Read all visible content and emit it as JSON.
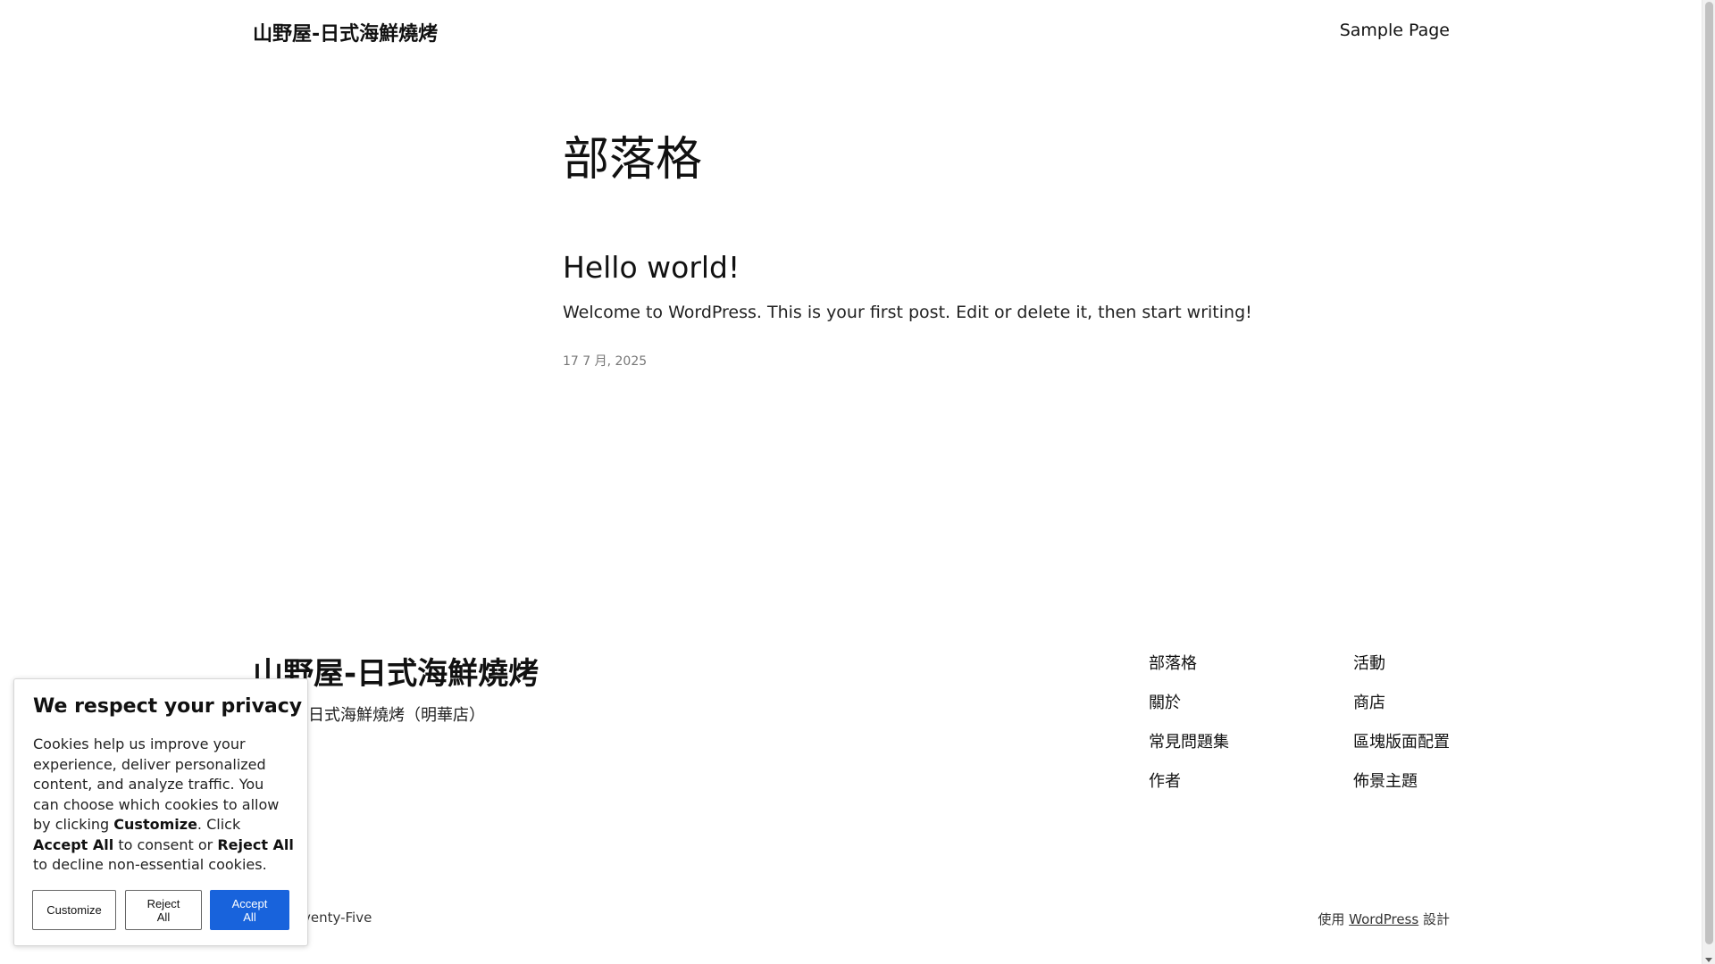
{
  "header": {
    "site_title": "山野屋-日式海鮮燒烤",
    "nav": {
      "sample_page": "Sample Page"
    }
  },
  "main": {
    "page_heading": "部落格",
    "posts": [
      {
        "title": "Hello world!",
        "excerpt": "Welcome to WordPress. This is your first post. Edit or delete it, then start writing!",
        "date": "17 7 月, 2025"
      }
    ]
  },
  "footer": {
    "site_title": "山野屋-日式海鮮燒烤",
    "tagline_visible": "日式海鮮燒烤（明華店）",
    "nav_col1": [
      "部落格",
      "關於",
      "常見問題集",
      "作者"
    ],
    "nav_col2": [
      "活動",
      "商店",
      "區塊版面配置",
      "佈景主題"
    ],
    "credit_left_visible": "venty-Five",
    "credit_right": {
      "prefix": "使用",
      "link": "WordPress",
      "suffix": "設計"
    }
  },
  "cookie_banner": {
    "title": "We respect your privacy",
    "text_1": "Cookies help us improve your experience, deliver personalized content, and analyze traffic. You can choose which cookies to allow by clicking ",
    "bold_customize": "Customize",
    "text_2": ". Click ",
    "bold_accept": "Accept All",
    "text_3": " to consent or ",
    "bold_reject": "Reject All",
    "text_4": " to decline non-essential cookies.",
    "buttons": {
      "customize": "Customize",
      "reject": "Reject All",
      "accept": "Accept All"
    },
    "accent_color": "#1863dc"
  }
}
